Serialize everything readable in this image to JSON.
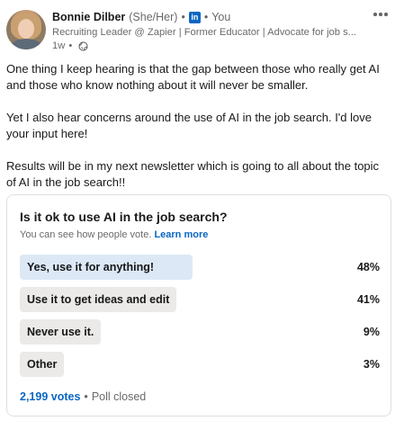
{
  "author": {
    "name": "Bonnie Dilber",
    "pronouns": "(She/Her)",
    "relationship": "You",
    "headline": "Recruiting Leader @ Zapier | Former Educator | Advocate for job s...",
    "time": "1w",
    "badge_text": "in",
    "brand_color": "#0a66c2"
  },
  "post": {
    "paragraphs": [
      "One thing I keep hearing is that the gap between those who really get AI and those who know nothing about it will never be smaller.",
      "Yet I also hear concerns around the use of AI in the job search. I'd love your input here!",
      "Results will be in my next newsletter which is going to all about the topic of AI in the job search!!"
    ]
  },
  "poll": {
    "question": "Is it ok to use AI in the job search?",
    "visibility_note": "You can see how people vote.",
    "learn_more": "Learn more",
    "options": [
      {
        "label": "Yes, use it for anything!",
        "percent_label": "48%",
        "share": 0.48,
        "selected": true
      },
      {
        "label": "Use it to get ideas and edit",
        "percent_label": "41%",
        "share": 0.41,
        "selected": false
      },
      {
        "label": "Never use it.",
        "percent_label": "9%",
        "share": 0.09,
        "selected": false
      },
      {
        "label": "Other",
        "percent_label": "3%",
        "share": 0.03,
        "selected": false
      }
    ],
    "votes": "2,199 votes",
    "status": "Poll closed",
    "selected_color": "#dce8f5",
    "bar_color": "#ebeae8"
  },
  "icons": {
    "more": "more-options-icon",
    "visibility": "globe-icon",
    "network": "linkedin-icon"
  }
}
